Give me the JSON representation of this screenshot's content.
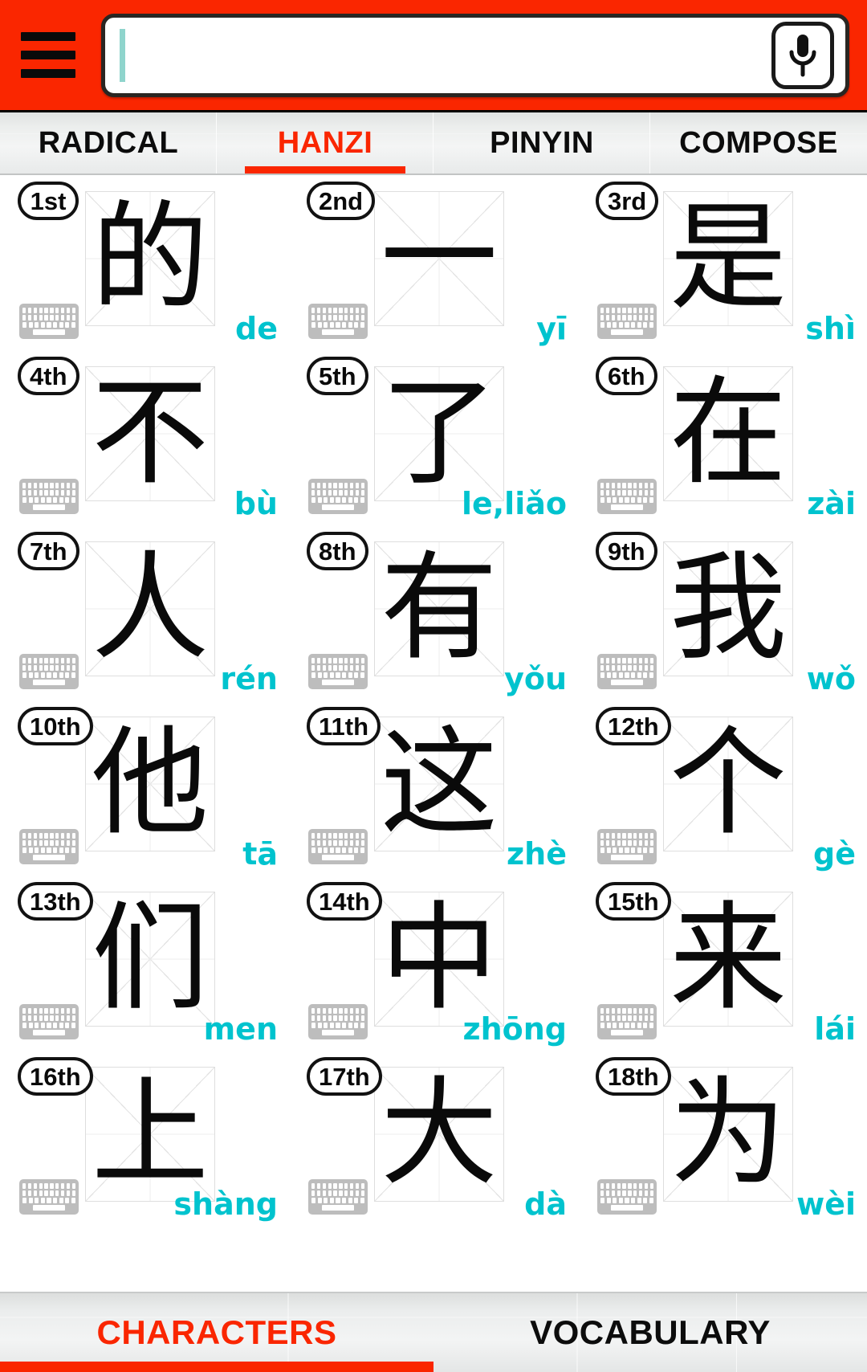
{
  "header": {
    "menu_icon": "hamburger-menu-icon",
    "search_value": "",
    "search_placeholder": "",
    "mic_icon": "microphone-icon",
    "background_color": "#fa2600"
  },
  "tabs": {
    "items": [
      {
        "label": "RADICAL",
        "active": false
      },
      {
        "label": "HANZI",
        "active": true
      },
      {
        "label": "PINYIN",
        "active": false
      },
      {
        "label": "COMPOSE",
        "active": false
      }
    ],
    "active_color": "#fa2600",
    "inactive_color": "#0c0c0c"
  },
  "characters": {
    "pinyin_color": "#00c3ce",
    "keyboard_icon": "keyboard-icon",
    "items": [
      {
        "order": "1st",
        "hanzi": "的",
        "pinyin": "de"
      },
      {
        "order": "2nd",
        "hanzi": "一",
        "pinyin": "yī"
      },
      {
        "order": "3rd",
        "hanzi": "是",
        "pinyin": "shì"
      },
      {
        "order": "4th",
        "hanzi": "不",
        "pinyin": "bù"
      },
      {
        "order": "5th",
        "hanzi": "了",
        "pinyin": "le,liǎo"
      },
      {
        "order": "6th",
        "hanzi": "在",
        "pinyin": "zài"
      },
      {
        "order": "7th",
        "hanzi": "人",
        "pinyin": "rén"
      },
      {
        "order": "8th",
        "hanzi": "有",
        "pinyin": "yǒu"
      },
      {
        "order": "9th",
        "hanzi": "我",
        "pinyin": "wǒ"
      },
      {
        "order": "10th",
        "hanzi": "他",
        "pinyin": "tā"
      },
      {
        "order": "11th",
        "hanzi": "这",
        "pinyin": "zhè"
      },
      {
        "order": "12th",
        "hanzi": "个",
        "pinyin": "gè"
      },
      {
        "order": "13th",
        "hanzi": "们",
        "pinyin": "men"
      },
      {
        "order": "14th",
        "hanzi": "中",
        "pinyin": "zhōng"
      },
      {
        "order": "15th",
        "hanzi": "来",
        "pinyin": "lái"
      },
      {
        "order": "16th",
        "hanzi": "上",
        "pinyin": "shàng"
      },
      {
        "order": "17th",
        "hanzi": "大",
        "pinyin": "dà"
      },
      {
        "order": "18th",
        "hanzi": "为",
        "pinyin": "wèi"
      }
    ]
  },
  "bottom_nav": {
    "items": [
      {
        "label": "CHARACTERS",
        "active": true
      },
      {
        "label": "VOCABULARY",
        "active": false
      }
    ],
    "active_color": "#fa2600"
  }
}
